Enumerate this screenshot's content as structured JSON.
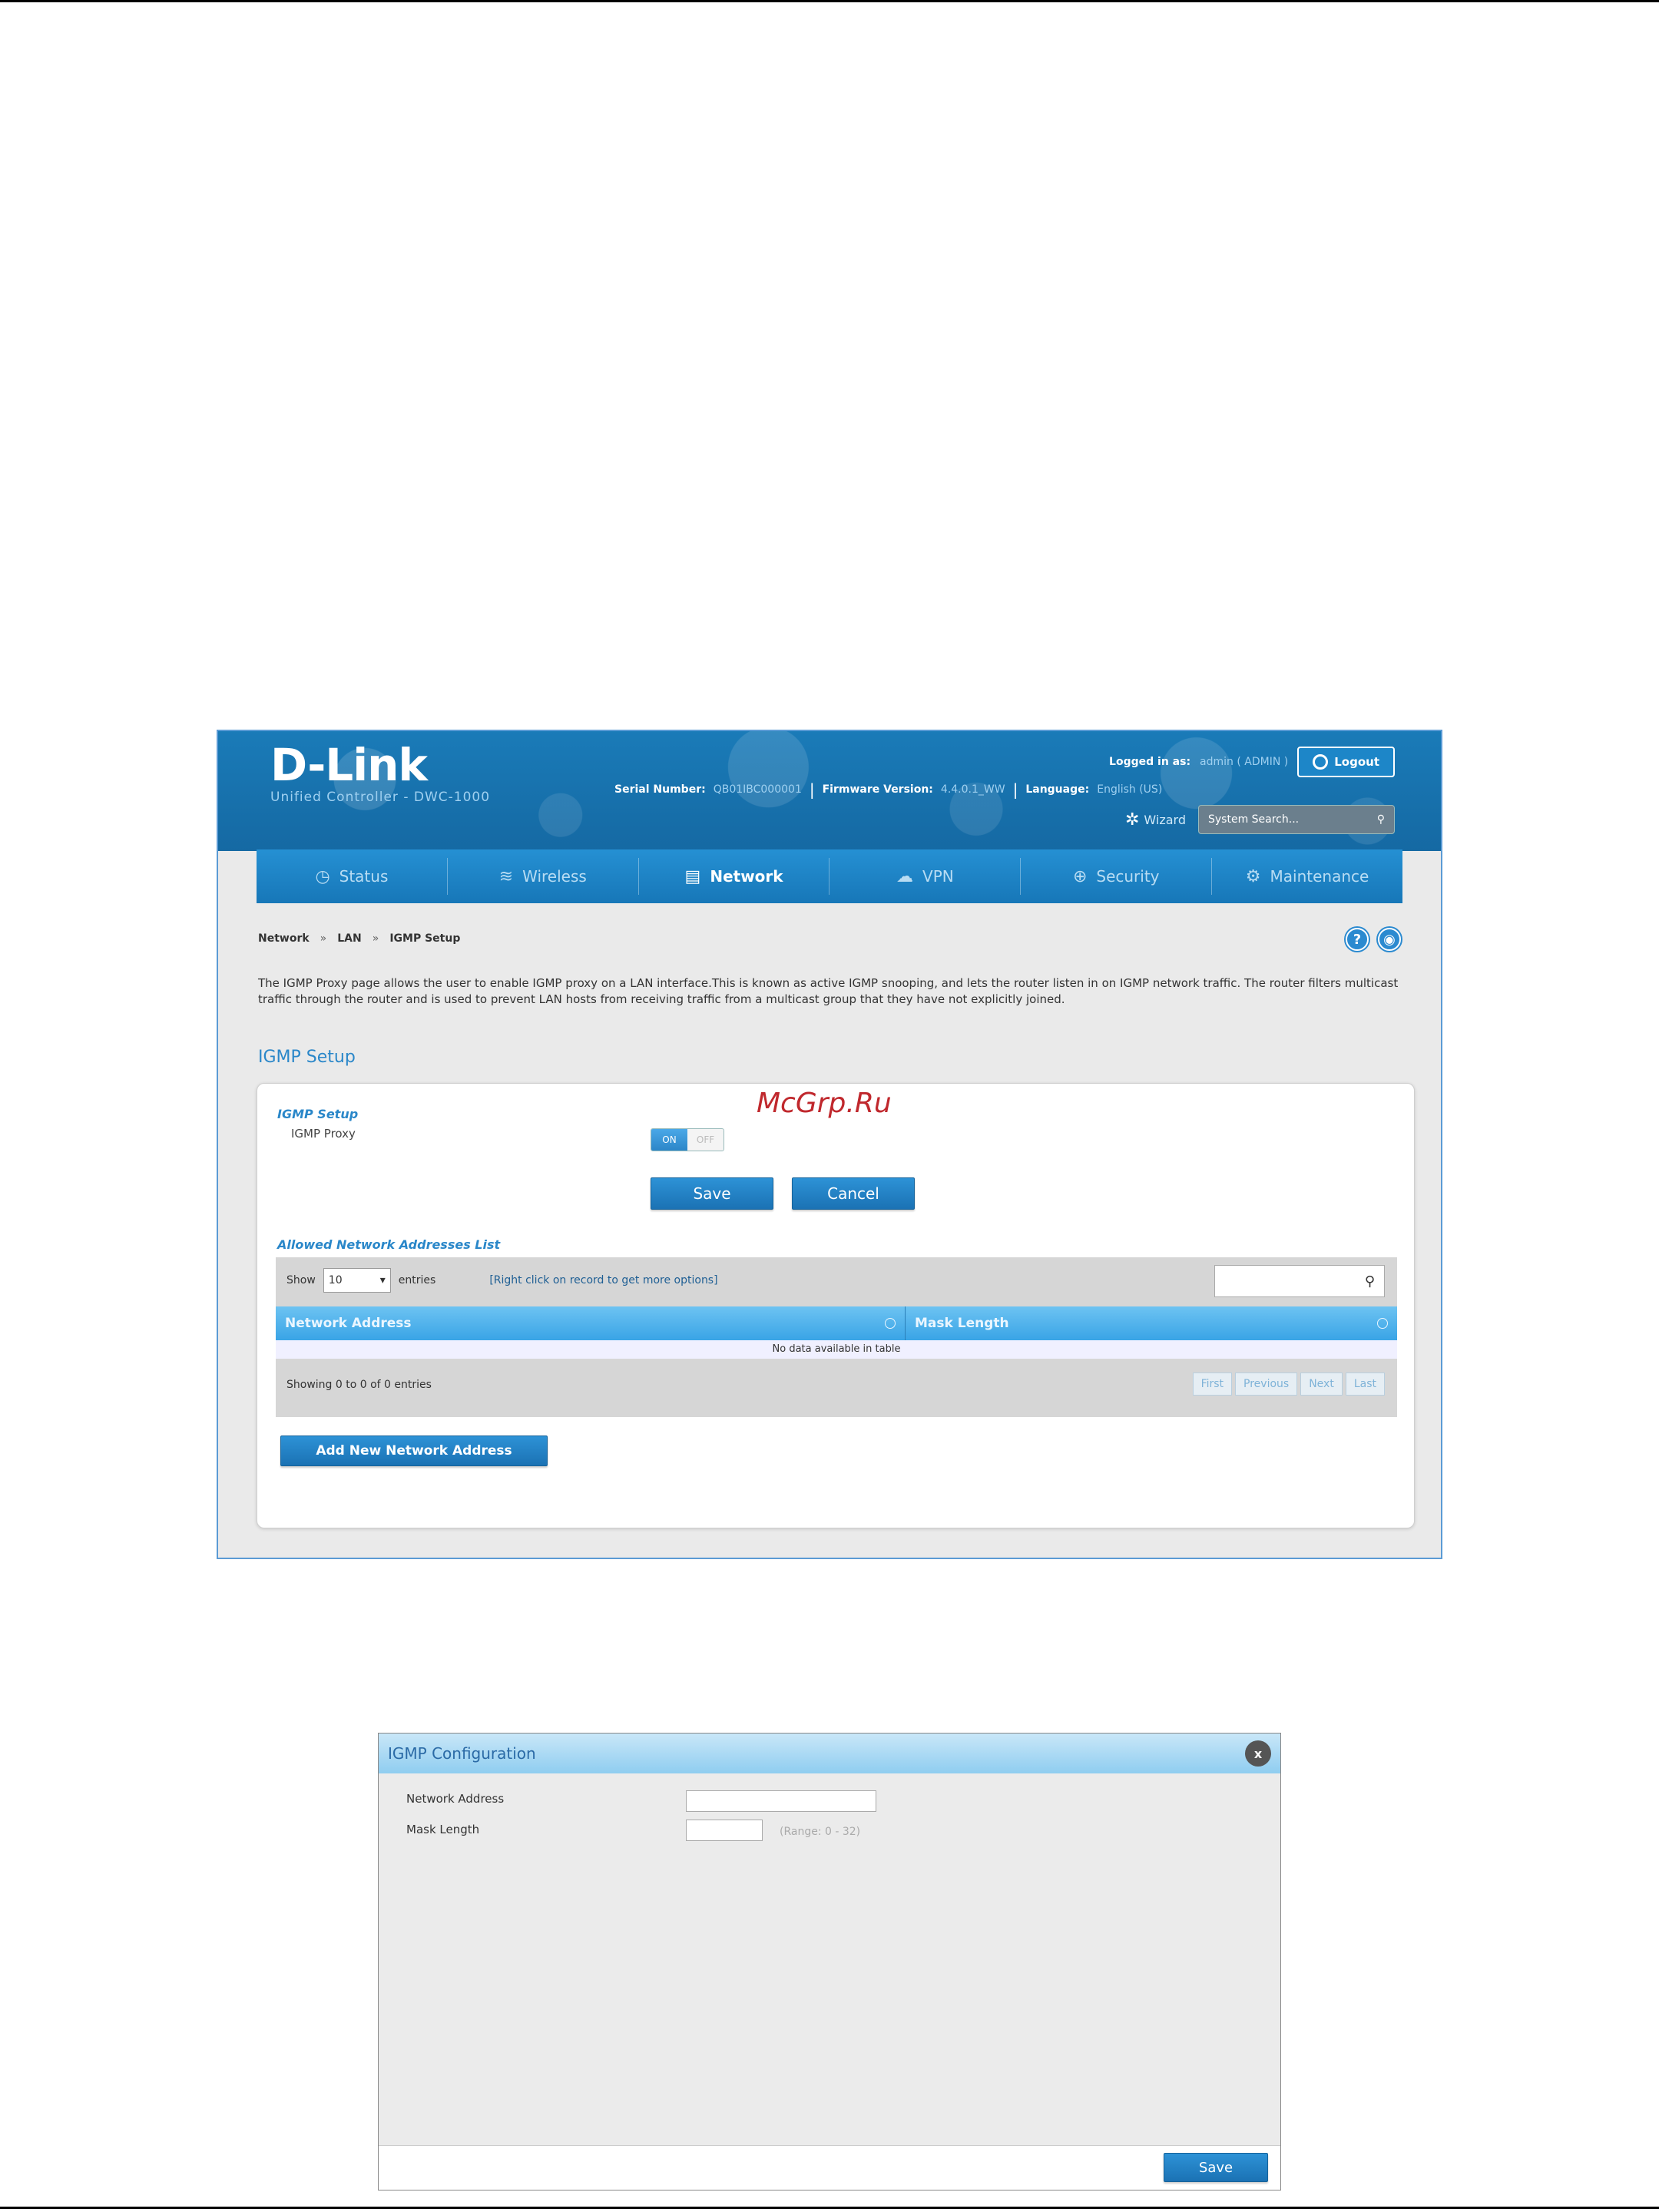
{
  "header": {
    "logo": "D-Link",
    "logo_sub": "Unified Controller - DWC-1000",
    "logged_in_label": "Logged in as:",
    "logged_in_value": "admin ( ADMIN )",
    "logout": "Logout",
    "serial_label": "Serial Number:",
    "serial_value": "QB01IBC000001",
    "firmware_label": "Firmware Version:",
    "firmware_value": "4.4.0.1_WW",
    "language_label": "Language:",
    "language_value": "English (US)",
    "wizard": "Wizard",
    "search_placeholder": "System Search..."
  },
  "nav": {
    "items": [
      {
        "label": "Status",
        "icon": "gauge-icon"
      },
      {
        "label": "Wireless",
        "icon": "wifi-icon"
      },
      {
        "label": "Network",
        "icon": "network-icon"
      },
      {
        "label": "VPN",
        "icon": "cloud-icon"
      },
      {
        "label": "Security",
        "icon": "lock-icon"
      },
      {
        "label": "Maintenance",
        "icon": "gear-icon"
      }
    ],
    "active": "Network"
  },
  "breadcrumb": [
    "Network",
    "LAN",
    "IGMP Setup"
  ],
  "description": "The IGMP Proxy page allows the user to enable IGMP proxy on a LAN interface.This is known as active IGMP snooping, and lets the router listen in on IGMP network traffic. The router filters multicast traffic through the router and is used to prevent LAN hosts from receiving traffic from a multicast group that they have not explicitly joined.",
  "section_title": "IGMP Setup",
  "form": {
    "subhead": "IGMP Setup",
    "proxy_label": "IGMP Proxy",
    "toggle_on": "ON",
    "toggle_off": "OFF",
    "save": "Save",
    "cancel": "Cancel"
  },
  "list": {
    "title": "Allowed Network Addresses List",
    "show_label": "Show",
    "show_value": "10",
    "entries_label": "entries",
    "hint": "[Right click on record to get more options]",
    "columns": [
      "Network Address",
      "Mask Length"
    ],
    "empty": "No data available in table",
    "footer": "Showing 0 to 0 of 0 entries",
    "pager": [
      "First",
      "Previous",
      "Next",
      "Last"
    ],
    "add_button": "Add New Network Address"
  },
  "watermark": "McGrp.Ru",
  "dialog": {
    "title": "IGMP Configuration",
    "close": "x",
    "network_address_label": "Network Address",
    "mask_length_label": "Mask Length",
    "mask_hint": "(Range: 0 - 32)",
    "save": "Save"
  }
}
